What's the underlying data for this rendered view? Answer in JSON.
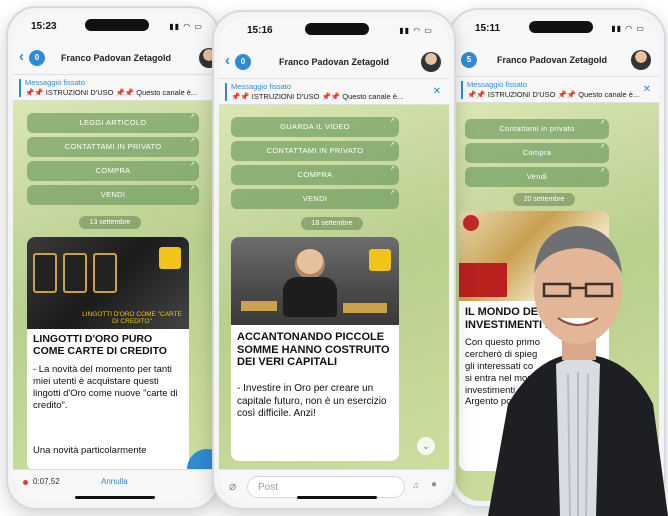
{
  "phone_left": {
    "time": "15:23",
    "title": "Franco Padovan Zetagold",
    "pinned_label": "Messaggio fissato",
    "pinned_text": "📌📌 ISTRUZIONI D'USO 📌📌 Questo canale è...",
    "buttons": [
      "LEGGI ARTICOLO",
      "CONTATTAMI IN PRIVATO",
      "COMPRA",
      "VENDI"
    ],
    "date": "13 settembre",
    "image_caption": "LINGOTTI D'ORO COME \"CARTE DI CREDITO\"",
    "card_title": "LINGOTTI D'ORO PURO COME CARTE DI CREDITO",
    "card_body": "- La novità del momento per tanti miei utenti è acquistare questi lingotti d'Oro come nuove \"carte di credito\".",
    "card_body2": "Una novità particolarmente",
    "footer_time": "0:07,52",
    "footer_cancel": "Annulla"
  },
  "phone_mid": {
    "time": "15:16",
    "title": "Franco Padovan Zetagold",
    "pinned_label": "Messaggio fissato",
    "pinned_text": "📌📌 ISTRUZIONI D'USO 📌📌 Questo canale è...",
    "buttons": [
      "GUARDA IL VIDEO",
      "CONTATTAMI IN PRIVATO",
      "COMPRA",
      "VENDI"
    ],
    "date": "18 settembre",
    "card_title": "ACCANTONANDO PICCOLE SOMME HANNO COSTRUITO DEI VERI CAPITALI",
    "card_body": "- Investire in Oro per creare un capitale futuro, non è un esercizio così difficile. Anzi!",
    "input_placeholder": "Post"
  },
  "phone_right": {
    "time": "15:11",
    "title": "Franco Padovan Zetagold",
    "pinned_label": "Messaggio fissato",
    "pinned_text": "📌📌 ISTRUZIONI D'USO 📌📌 Questo canale è...",
    "buttons": [
      "Contattami in privato",
      "Compra",
      "Vendi"
    ],
    "date": "20 settembre",
    "card_title": "IL MONDO DEGLI INVESTIMENTI IN ORO",
    "card_body_lines": [
      "Con questo primo",
      "cercherò di spieg",
      "gli interessati co",
      "si entra nel mon",
      "investimenti",
      "Argento po"
    ]
  },
  "colors": {
    "accent": "#2f8bd3",
    "chat_bg": "#cfdca8",
    "button_bg": "#5a8c50"
  }
}
